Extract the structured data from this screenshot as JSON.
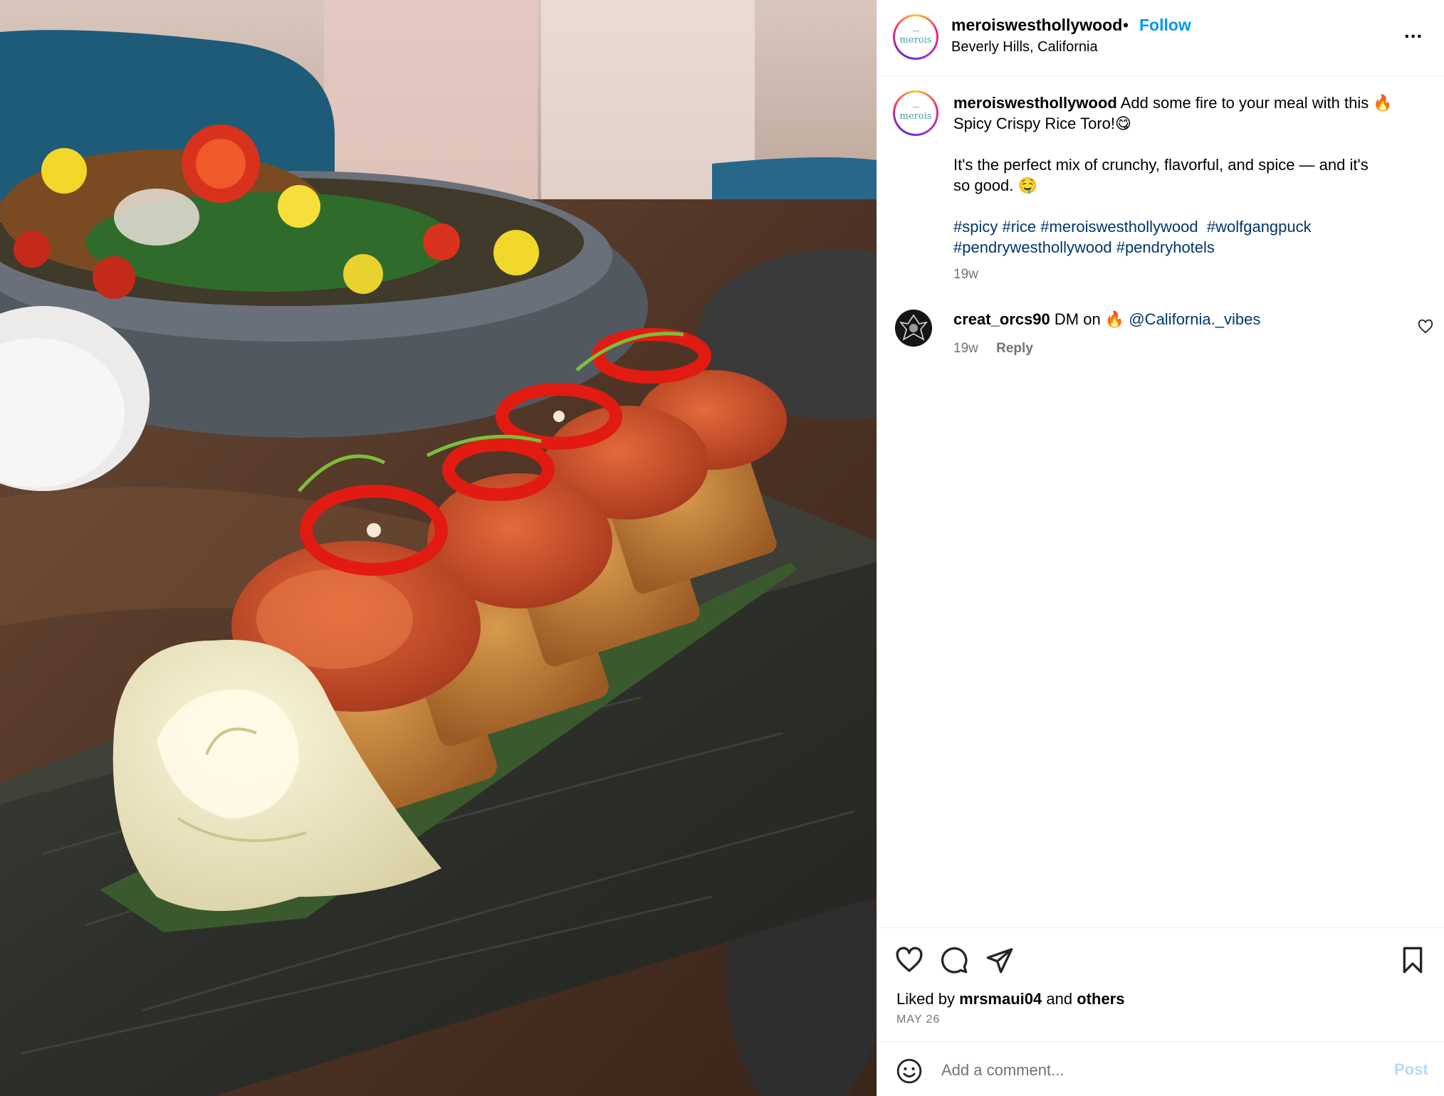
{
  "post": {
    "username": "meroiswesthollywood",
    "separator": "•",
    "follow_label": "Follow",
    "location": "Beverly Hills, California",
    "more_label": "...",
    "avatar_mark": "~~",
    "avatar_word": "merois"
  },
  "caption": {
    "username": "meroiswesthollywood",
    "line1": "Add some fire to your meal with this 🔥",
    "line2": "Spicy Crispy Rice Toro!😋",
    "line3": "It's the perfect mix of crunchy, flavorful, and spice — and it's",
    "line4": "so good. 🤤",
    "hashtags": [
      "#spicy",
      "#rice",
      "#meroiswesthollywood",
      "#wolfgangpuck",
      "#pendrywesthollywood",
      "#pendryhotels"
    ],
    "time": "19w"
  },
  "comments": [
    {
      "username": "creat_orcs90",
      "text": "DM on 🔥",
      "mention": "@California._vibes",
      "time": "19w",
      "reply_label": "Reply"
    }
  ],
  "footer": {
    "liked_prefix": "Liked by",
    "liked_user": "mrsmaui04",
    "liked_and": "and",
    "liked_others": "others",
    "date": "MAY 26",
    "comment_placeholder": "Add a comment...",
    "post_label": "Post",
    "post_color": "#b3dbff"
  },
  "colors": {
    "link_blue": "#0095f6",
    "hashtag_blue": "#00376b",
    "secondary_text": "#737373"
  },
  "icons": [
    "more-icon",
    "heart-icon",
    "comment-icon",
    "share-icon",
    "bookmark-icon",
    "emoji-icon",
    "small-heart-icon"
  ]
}
